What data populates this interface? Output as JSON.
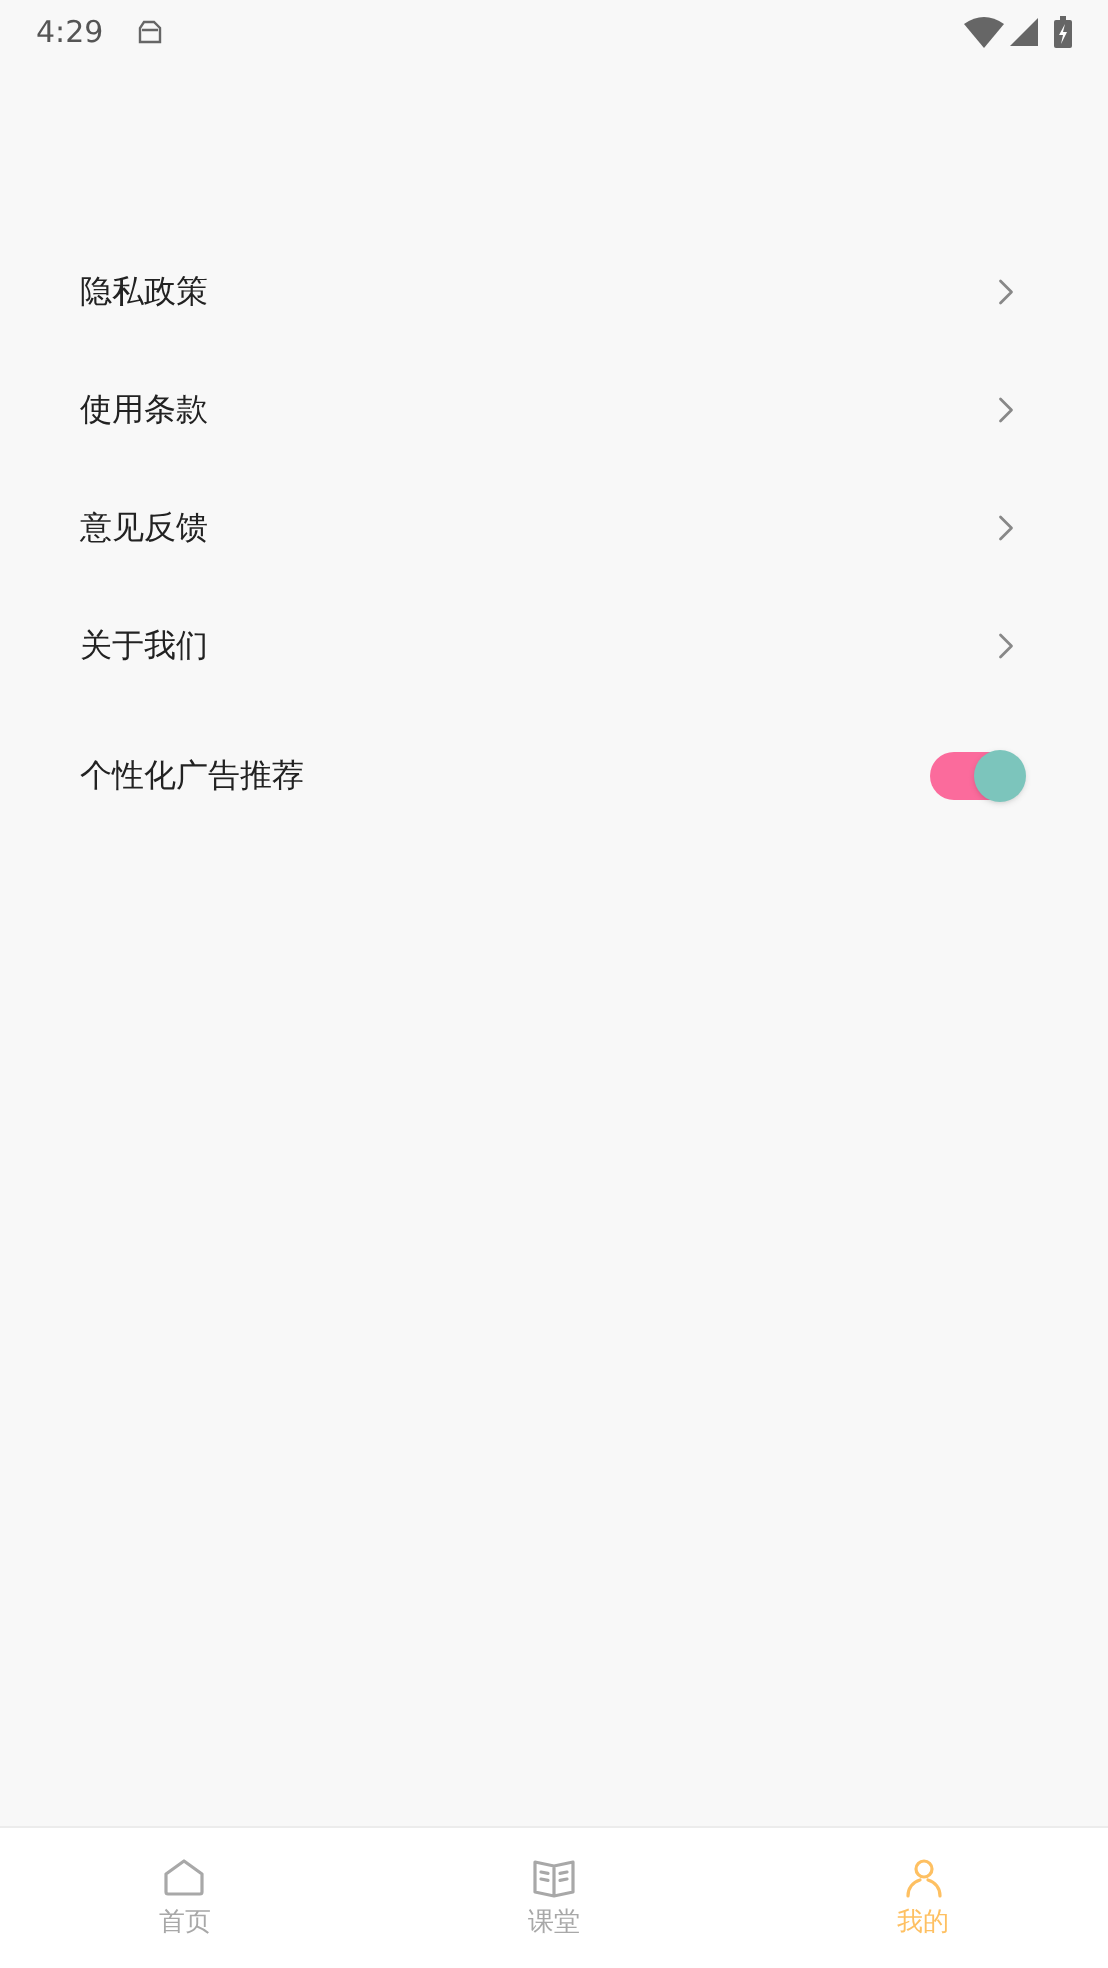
{
  "status_bar": {
    "time": "4:29"
  },
  "settings": [
    {
      "kind": "link",
      "label": "隐私政策"
    },
    {
      "kind": "link",
      "label": "使用条款"
    },
    {
      "kind": "link",
      "label": "意见反馈"
    },
    {
      "kind": "link",
      "label": "关于我们"
    },
    {
      "kind": "toggle",
      "label": "个性化广告推荐",
      "on": true
    }
  ],
  "tabs": [
    {
      "label": "首页",
      "selected": false
    },
    {
      "label": "课堂",
      "selected": false
    },
    {
      "label": "我的",
      "selected": true
    }
  ]
}
